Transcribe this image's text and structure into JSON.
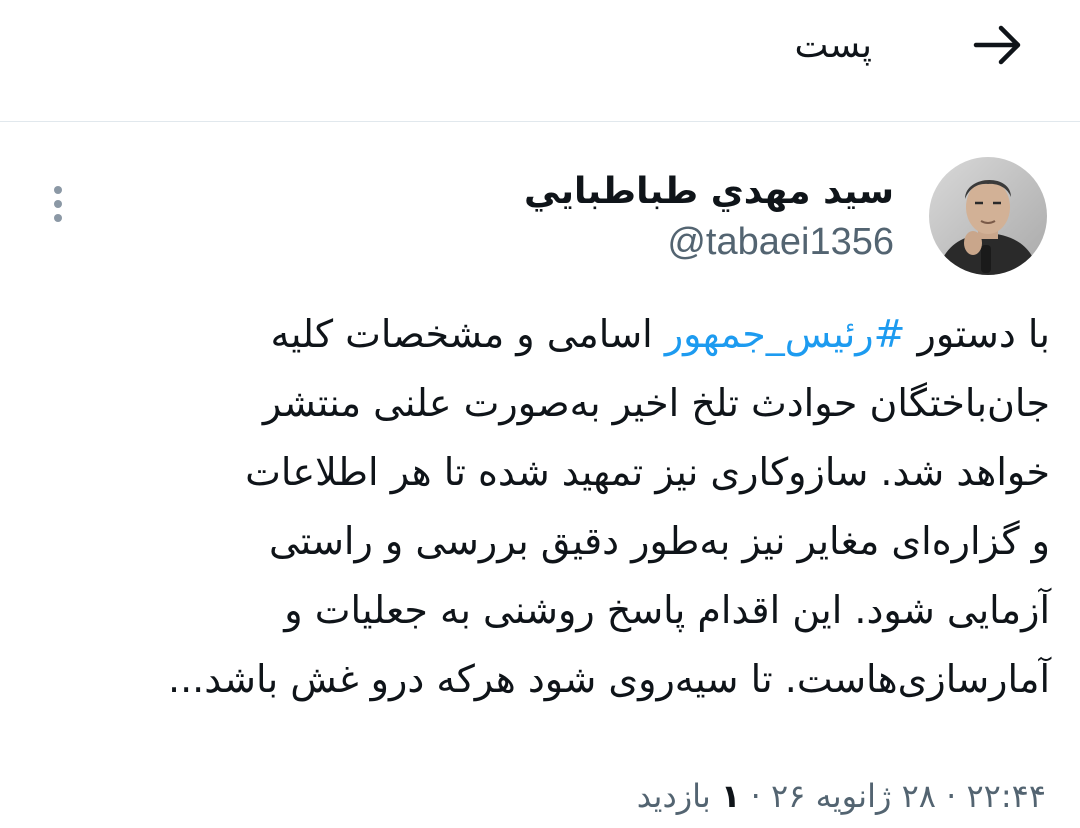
{
  "header": {
    "title": "پست",
    "back_icon": "arrow-right-icon"
  },
  "tweet": {
    "display_name": "سيد مهدي طباطبايي",
    "handle": "@tabaei1356",
    "avatar_icon": "user-avatar",
    "more_icon": "more-vertical-icon",
    "lines": [
      {
        "pre": "با دستور ",
        "hashtag": "#رئیس_جمهور",
        "post": " اسامی و مشخصات کلیه"
      },
      {
        "text": "جان‌باختگان حوادث تلخ اخیر  به‌صورت علنی منتشر"
      },
      {
        "text": "خواهد شد. سازوکاری نیز تمهید شده تا هر اطلاعات"
      },
      {
        "text": "و گزاره‌ای مغایر نیز به‌طور دقیق بررسی و راستی"
      },
      {
        "text": "آزمایی شود. این اقدام پاسخ روشنی به جعلیات و"
      },
      {
        "text": "آمارسازی‌هاست. تا سیه‌روی شود هرکه درو غش باشد..."
      }
    ],
    "time": "۲۲:۴۴",
    "separator": "·",
    "date": "۲۸ ژانویه ۲۶",
    "views_count": "۱",
    "views_label": "بازدید"
  },
  "colors": {
    "hashtag": "#1d9bf0",
    "secondary_text": "#536471",
    "divider": "#e1e8ed"
  }
}
